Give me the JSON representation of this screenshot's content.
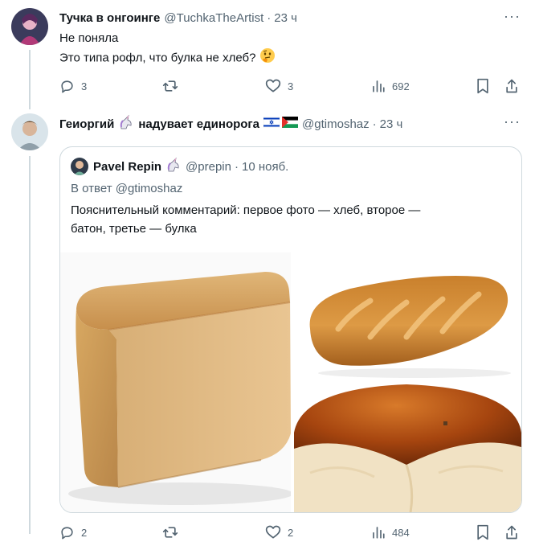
{
  "tweet1": {
    "display_name": "Тучка в онгоинге",
    "handle": "@TuchkaTheArtist",
    "time": "23 ч",
    "text_line1": "Не поняла",
    "text_line2": "Это типа рофл, что булка не хлеб?",
    "replies": "3",
    "likes": "3",
    "views": "692"
  },
  "tweet2": {
    "display_name": "Геиоргий",
    "name_suffix": "надувает единорога",
    "handle": "@gtimoshaz",
    "time": "23 ч",
    "replies": "2",
    "likes": "2",
    "views": "484"
  },
  "quote": {
    "display_name": "Pavel Repin",
    "handle": "@prepin",
    "time": "10 нояб.",
    "reply_to": "В ответ @gtimoshaz",
    "text_line1": "Пояснительный комментарий: первое фото — хлеб, второе —",
    "text_line2": "батон, третье — булка"
  },
  "icons": {
    "reply": "reply-icon",
    "retweet": "retweet-icon",
    "like": "heart-icon",
    "views": "views-icon",
    "bookmark": "bookmark-icon",
    "share": "share-icon",
    "more": "more-icon"
  },
  "colors": {
    "text": "#0f1419",
    "muted": "#536471",
    "border": "#cfd9de"
  }
}
